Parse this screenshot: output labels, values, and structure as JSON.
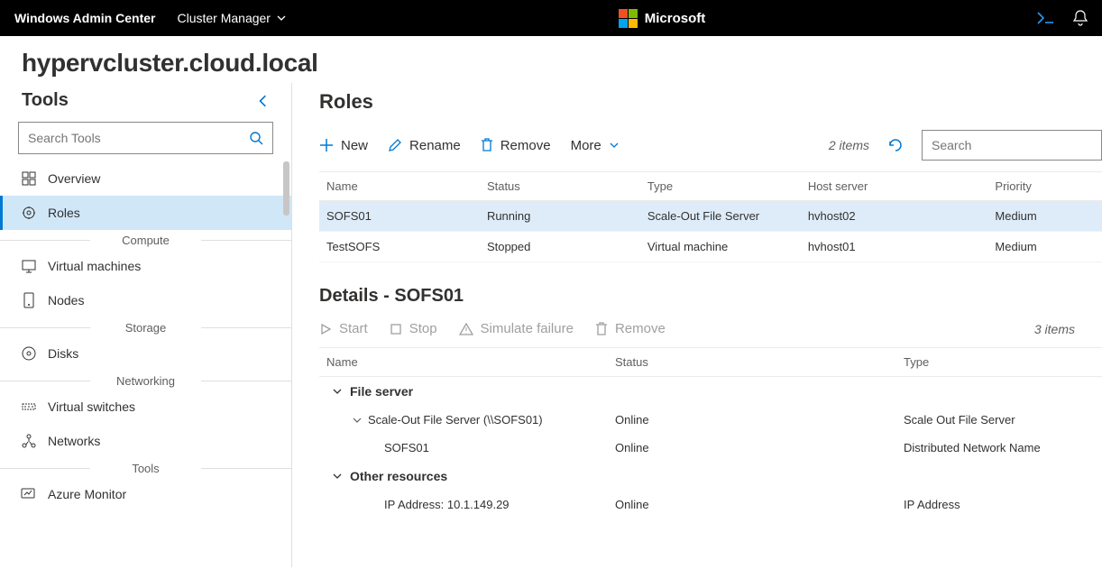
{
  "topbar": {
    "wac": "Windows Admin Center",
    "context": "Cluster Manager",
    "brand": "Microsoft"
  },
  "cluster": {
    "name": "hypervcluster.cloud.local"
  },
  "sidebar": {
    "title": "Tools",
    "search_placeholder": "Search Tools",
    "items": [
      {
        "label": "Overview"
      },
      {
        "label": "Roles"
      },
      {
        "group": "Compute"
      },
      {
        "label": "Virtual machines"
      },
      {
        "label": "Nodes"
      },
      {
        "group": "Storage"
      },
      {
        "label": "Disks"
      },
      {
        "group": "Networking"
      },
      {
        "label": "Virtual switches"
      },
      {
        "label": "Networks"
      },
      {
        "group": "Tools"
      },
      {
        "label": "Azure Monitor"
      }
    ]
  },
  "roles": {
    "title": "Roles",
    "toolbar": {
      "new": "New",
      "rename": "Rename",
      "remove": "Remove",
      "more": "More"
    },
    "count": "2 items",
    "search_placeholder": "Search",
    "cols": {
      "name": "Name",
      "status": "Status",
      "type": "Type",
      "host": "Host server",
      "priority": "Priority"
    },
    "rows": [
      {
        "name": "SOFS01",
        "status": "Running",
        "type": "Scale-Out File Server",
        "host": "hvhost02",
        "priority": "Medium"
      },
      {
        "name": "TestSOFS",
        "status": "Stopped",
        "type": "Virtual machine",
        "host": "hvhost01",
        "priority": "Medium"
      }
    ]
  },
  "details": {
    "title": "Details - SOFS01",
    "toolbar": {
      "start": "Start",
      "stop": "Stop",
      "simfail": "Simulate failure",
      "remove": "Remove"
    },
    "count": "3 items",
    "cols": {
      "name": "Name",
      "status": "Status",
      "type": "Type"
    },
    "groups": [
      {
        "label": "File server",
        "rows": [
          {
            "name": "Scale-Out File Server (\\\\SOFS01)",
            "status": "Online",
            "type": "Scale Out File Server",
            "expandable": true
          },
          {
            "name": "SOFS01",
            "status": "Online",
            "type": "Distributed Network Name",
            "indent": 2
          }
        ]
      },
      {
        "label": "Other resources",
        "rows": [
          {
            "name": "IP Address: 10.1.149.29",
            "status": "Online",
            "type": "IP Address",
            "indent": 2
          }
        ]
      }
    ]
  }
}
